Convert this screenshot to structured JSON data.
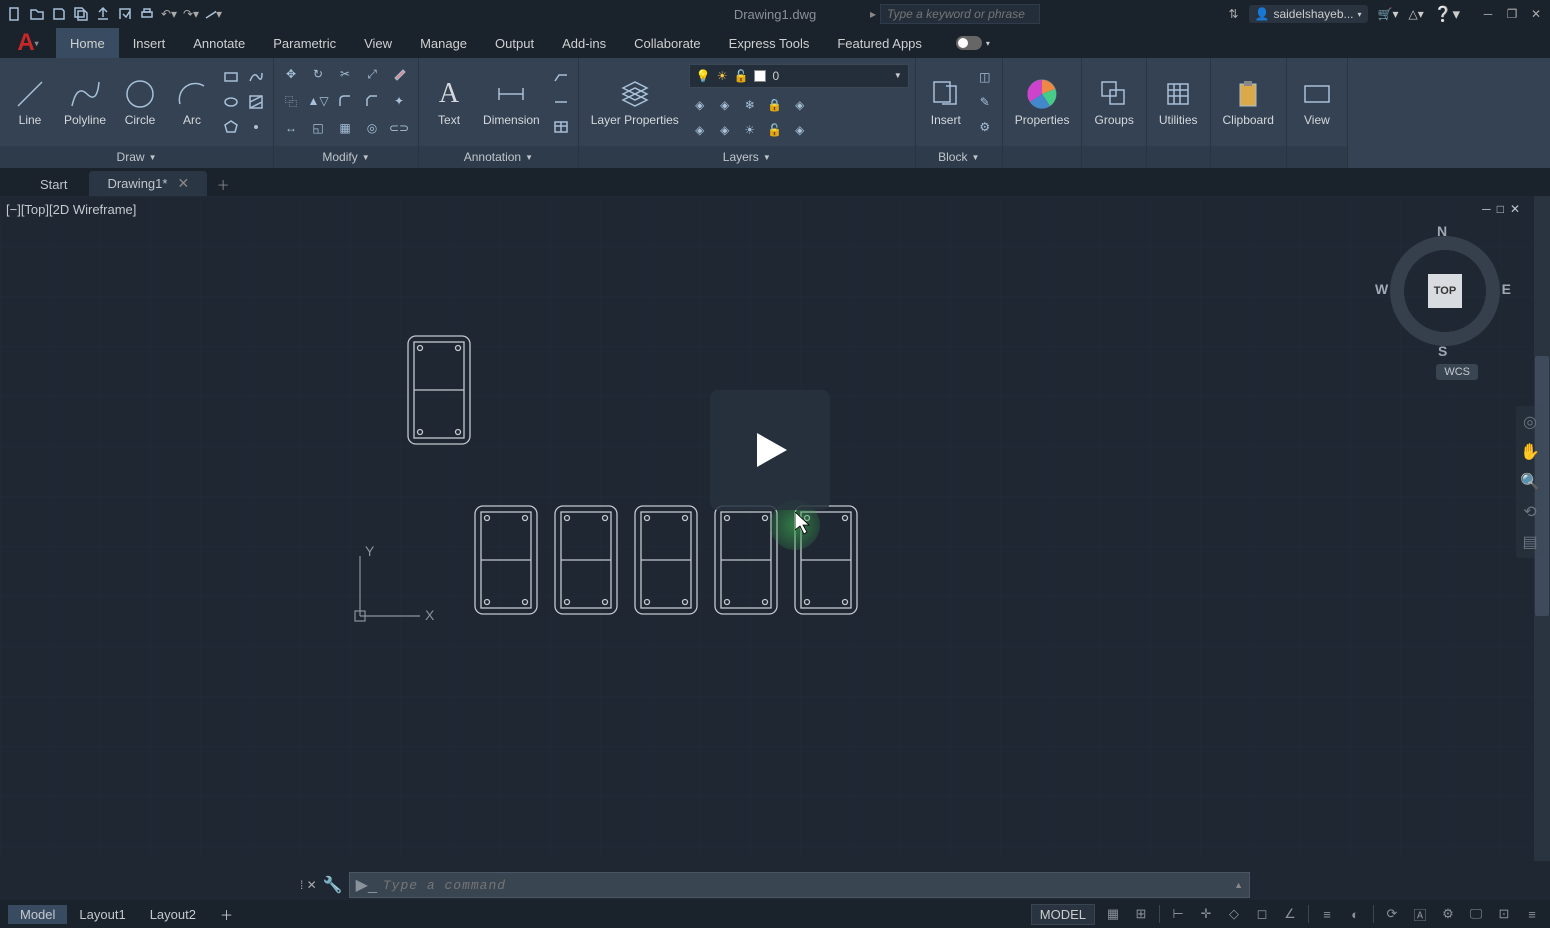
{
  "titlebar": {
    "doc_title": "Drawing1.dwg",
    "search_placeholder": "Type a keyword or phrase",
    "user": "saidelshayeb...",
    "qat_icons": [
      "new",
      "open",
      "save",
      "saveall",
      "publish",
      "plot",
      "print",
      "undo",
      "redo",
      "line-drop"
    ]
  },
  "ribbon_tabs": [
    "Home",
    "Insert",
    "Annotate",
    "Parametric",
    "View",
    "Manage",
    "Output",
    "Add-ins",
    "Collaborate",
    "Express Tools",
    "Featured Apps"
  ],
  "active_tab": "Home",
  "panels": {
    "draw": {
      "title": "Draw",
      "btns": [
        "Line",
        "Polyline",
        "Circle",
        "Arc"
      ]
    },
    "modify": {
      "title": "Modify"
    },
    "annotation": {
      "title": "Annotation",
      "btns": [
        "Text",
        "Dimension"
      ]
    },
    "layers": {
      "title": "Layers",
      "btn": "Layer Properties",
      "current": "0"
    },
    "block": {
      "title": "Block",
      "btn": "Insert"
    },
    "props": {
      "label": "Properties"
    },
    "groups": {
      "label": "Groups"
    },
    "utilities": {
      "label": "Utilities"
    },
    "clipboard": {
      "label": "Clipboard"
    },
    "view": {
      "label": "View"
    }
  },
  "doctabs": {
    "start": "Start",
    "drawing": "Drawing1*"
  },
  "canvas": {
    "view_label": "[−][Top][2D Wireframe]",
    "viewcube_face": "TOP",
    "dirs": {
      "n": "N",
      "s": "S",
      "e": "E",
      "w": "W"
    },
    "wcs": "WCS",
    "ucs_x": "X",
    "ucs_y": "Y"
  },
  "cmd": {
    "placeholder": "Type a command"
  },
  "statusbar": {
    "model": "Model",
    "layouts": [
      "Layout1",
      "Layout2"
    ],
    "model_label": "MODEL"
  }
}
